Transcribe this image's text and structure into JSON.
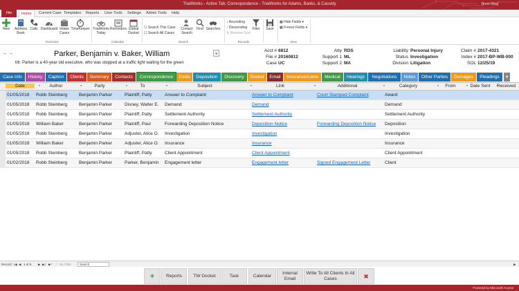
{
  "app": {
    "title": "TrialWorks - Active Tab: Correspondence - TrialWorks for Adams, Banks, & Cassidy",
    "user": "Brent Ming"
  },
  "menu": {
    "items": [
      "File",
      "Home",
      "Current Case",
      "Templates",
      "Reports",
      "User Tools",
      "Settings",
      "Admin Tools",
      "Help"
    ]
  },
  "ribbon": {
    "buttons": {
      "new": "New",
      "address_book": "Address Book",
      "calls": "Calls",
      "dashboard": "Dashboard",
      "intake": "Intake Cases",
      "timekeeper": "TimeKeeper",
      "tw_today": "TrialWorks Today",
      "reminders": "Reminders",
      "global_docket": "Global Docket",
      "search_this_case": "Search This Case",
      "search_all_cases": "Search All Cases",
      "contact_search": "Contact Search",
      "find": "Find",
      "searches": "Searches",
      "ascending": "Ascending",
      "descending": "Descending",
      "remove_sort": "Remove Sort",
      "filter": "Filter",
      "save": "Save",
      "hide_fields": "Hide Fields",
      "freeze_fields": "Freeze Fields"
    },
    "groups": {
      "overview": "Overview",
      "calendar": "Calendar",
      "search": "Search",
      "records": "Records",
      "view": "View"
    }
  },
  "case": {
    "name": "Parker, Benjamin v. Baker, William",
    "description": "Mr. Parker is a 40-year old executive, who was stopped at a traffic light waiting for the green",
    "nav_prev": "←",
    "nav_next": "→",
    "acct_label": "Acct #",
    "acct": "6812",
    "file_label": "File #",
    "file": "20160812",
    "case_label": "Case",
    "case_code": "UC",
    "atty_label": "Atty",
    "atty": "RDS",
    "support1_label": "Support 1",
    "support1": "ML",
    "support2_label": "Support 2",
    "support2": "MA",
    "liability_label": "Liability",
    "liability": "Personal Injury",
    "status_label": "Status",
    "status": "Investigation",
    "division_label": "Division",
    "division": "Litigation",
    "claim_label": "Claim #",
    "claim": "2017-4321",
    "index_label": "Index #",
    "index": "2017-BP-WB-000",
    "sol_label": "SOL",
    "sol": "12/25/19"
  },
  "tabs": [
    {
      "label": "Case Info",
      "color": "#1f6fae"
    },
    {
      "label": "History",
      "color": "#b04aa8"
    },
    {
      "label": "Caption",
      "color": "#1f6fae"
    },
    {
      "label": "Clients",
      "color": "#c2312e"
    },
    {
      "label": "Summary",
      "color": "#d9591b"
    },
    {
      "label": "Contacts",
      "color": "#a0302a"
    },
    {
      "label": "Correspondence",
      "color": "#3e9a44"
    },
    {
      "label": "Costs",
      "color": "#f09a1a"
    },
    {
      "label": "Deposition",
      "color": "#1f8fb0"
    },
    {
      "label": "Discovery",
      "color": "#3e9a44"
    },
    {
      "label": "Docket",
      "color": "#f09a1a"
    },
    {
      "label": "Email",
      "color": "#8a2a2a"
    },
    {
      "label": "Insurance/Liens",
      "color": "#f09a1a"
    },
    {
      "label": "Medical",
      "color": "#3e9a44"
    },
    {
      "label": "Hearings",
      "color": "#1f8fb0"
    },
    {
      "label": "Negotiations",
      "color": "#1f6fae"
    },
    {
      "label": "Notes",
      "color": "#5b9bd5"
    },
    {
      "label": "Other Parties",
      "color": "#1f6fae"
    },
    {
      "label": "Damages",
      "color": "#f09a1a"
    },
    {
      "label": "Pleadings",
      "color": "#1f6fae"
    }
  ],
  "grid": {
    "columns": [
      "Date",
      "Author",
      "Party",
      "To",
      "Subject",
      "Link",
      "Additional",
      "Category",
      "From",
      "Date Sent",
      "Received"
    ],
    "rows": [
      [
        "01/05/2018",
        "Robb Steinberg",
        "Benjamin Parker",
        "Plaintiff, Patty",
        "Answer to Complaint",
        "Answer to Complaint",
        "Court Stamped Complaint",
        "Award",
        "",
        "",
        ""
      ],
      [
        "01/05/2018",
        "Robb Steinberg",
        "Benjamin Parker",
        "Disney, Walter E.",
        "Demand",
        "Demand",
        "",
        "Demand",
        "",
        "",
        ""
      ],
      [
        "01/05/2018",
        "Robb Steinberg",
        "Benjamin Parker",
        "Plaintiff, Patty",
        "Settlement Authority",
        "Settlement Authority",
        "",
        "Settlement Authority",
        "",
        "",
        ""
      ],
      [
        "01/05/2018",
        "William Baker",
        "Benjamin Parker",
        "Plaintiff, Paul",
        "Forwarding Deposition Notice",
        "Deposition Notice",
        "Forwarding Deposition Notice",
        "Deposition",
        "",
        "",
        ""
      ],
      [
        "01/05/2018",
        "Robb Steinberg",
        "Benjamin Parker",
        "Adjuster, Alice O.",
        "Investigation",
        "Investigation",
        "",
        "Investigation",
        "",
        "",
        ""
      ],
      [
        "01/05/2018",
        "William Baker",
        "Benjamin Parker",
        "Adjuster, Alice O.",
        "Insurance",
        "Insurance",
        "",
        "Insurance",
        "",
        "",
        ""
      ],
      [
        "01/05/2018",
        "Robb Steinberg",
        "Benjamin Parker",
        "Plaintiff, Patty",
        "Client Appointment",
        "Client Appointment",
        "",
        "Client Appointment",
        "",
        "",
        ""
      ],
      [
        "01/02/2018",
        "Robb Steinberg",
        "Benjamin Parker",
        "Parker, Benjamin",
        "Engagement letter",
        "Engagement letter",
        "Signed Engagement Letter",
        "Client",
        "",
        "",
        ""
      ]
    ]
  },
  "record_nav": {
    "record_label": "Record:",
    "position": "1 of 9",
    "filter": "No Filter",
    "search": "Search"
  },
  "bottom_buttons": {
    "add": "+",
    "reports": "Reports",
    "tw_docket": "TW Docket",
    "task": "Task",
    "calendar": "Calendar",
    "internal_email": "Internal Email",
    "write_all": "Write To All Clients In All Cases",
    "delete": "✖"
  },
  "statusbar": {
    "text": "Powered by Microsoft Access"
  },
  "colors": {
    "brand": "#a4262c",
    "selected_row": "#c7dff5",
    "link": "#1a5fb4"
  }
}
